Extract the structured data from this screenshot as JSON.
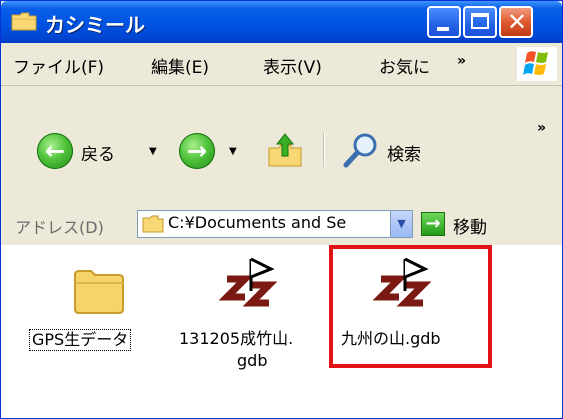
{
  "window": {
    "title": "カシミール"
  },
  "menubar": {
    "items": [
      "ファイル(F)",
      "編集(E)",
      "表示(V)",
      "お気に"
    ],
    "overflow": "»"
  },
  "toolbar": {
    "back_label": "戻る",
    "search_label": "検索",
    "overflow": "»"
  },
  "addressbar": {
    "label": "アドレス(D)",
    "path": "C:¥Documents and Se",
    "go_label": "移動"
  },
  "files": [
    {
      "name": "GPS生データ",
      "icon": "folder-icon"
    },
    {
      "name_line1": "131205成竹山.",
      "name_line2": "gdb",
      "icon": "gdb-file-icon"
    },
    {
      "name": "九州の山.gdb",
      "icon": "gdb-file-icon",
      "highlighted": true
    }
  ],
  "colors": {
    "titlebar": "#0054e3",
    "highlight": "#e01414",
    "gdb_icon": "#7a1a12"
  }
}
